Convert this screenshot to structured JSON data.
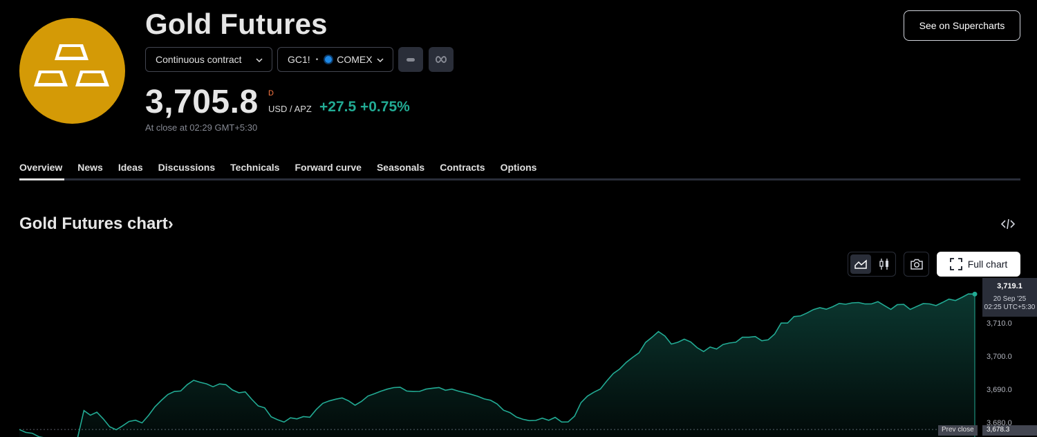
{
  "header": {
    "title": "Gold Futures",
    "contract_select": "Continuous contract",
    "symbol": "GC1!",
    "exchange": "COMEX",
    "see_supercharts": "See on Supercharts",
    "logo_icon": "gold-bars-icon"
  },
  "quote": {
    "price": "3,705.8",
    "period": "D",
    "currency": "USD / APZ",
    "change": "+27.5",
    "change_pct": "+0.75%",
    "close_time": "At close at 02:29 GMT+5:30",
    "up_color": "#22ab94"
  },
  "tabs": [
    "Overview",
    "News",
    "Ideas",
    "Discussions",
    "Technicals",
    "Forward curve",
    "Seasonals",
    "Contracts",
    "Options"
  ],
  "chart_section": {
    "title": "Gold Futures chart›",
    "full_chart": "Full chart",
    "tooltip": {
      "price": "3,719.1",
      "date": "20 Sep '25",
      "time": "02:25 UTC+5:30"
    },
    "prev_close_label": "Prev close",
    "prev_close_value": "3,678.3",
    "y_ticks": [
      "3,710.0",
      "3,700.0",
      "3,690.0",
      "3,680.0"
    ]
  },
  "chart_data": {
    "type": "area",
    "series": [
      {
        "values": [
          3678.3,
          3678.0,
          3677.2,
          3676.5,
          3676.0,
          3675.5,
          3675.2,
          3675.0,
          3675.0,
          3675.3,
          3684.0,
          3682.5,
          3683.0,
          3681.5,
          3679.0,
          3678.5,
          3680.0,
          3681.0,
          3681.5,
          3680.5,
          3683.0,
          3685.5,
          3687.5,
          3688.5,
          3689.2,
          3689.5,
          3691.5,
          3692.5,
          3692.0,
          3691.7,
          3691.8,
          3692.5,
          3692.0,
          3690.5,
          3689.5,
          3690.0,
          3688.0,
          3686.0,
          3684.5,
          3682.0,
          3681.0,
          3680.5,
          3681.5,
          3681.0,
          3682.0,
          3682.5,
          3684.5,
          3686.5,
          3687.0,
          3687.5,
          3688.0,
          3687.0,
          3685.5,
          3686.5,
          3688.0,
          3689.0,
          3689.5,
          3690.0,
          3690.5,
          3690.5,
          3690.0,
          3689.8,
          3690.3,
          3690.5,
          3690.8,
          3691.0,
          3690.5,
          3690.0,
          3689.5,
          3689.0,
          3688.5,
          3688.0,
          3687.0,
          3686.5,
          3685.5,
          3684.5,
          3683.5,
          3682.5,
          3681.5,
          3681.0,
          3681.5,
          3682.0,
          3680.5,
          3681.5,
          3680.0,
          3680.2,
          3682.0,
          3686.0,
          3688.0,
          3689.5,
          3691.0,
          3693.0,
          3695.5,
          3697.0,
          3699.0,
          3700.5,
          3702.0,
          3704.0,
          3705.5,
          3707.5,
          3706.0,
          3704.0,
          3704.0,
          3705.0,
          3705.0,
          3703.5,
          3702.0,
          3703.5,
          3703.0,
          3704.5,
          3704.5,
          3705.0,
          3705.5,
          3705.5,
          3706.0,
          3704.7,
          3705.0,
          3707.0,
          3710.0,
          3711.0,
          3712.5,
          3713.0,
          3714.0,
          3714.5,
          3715.0,
          3715.0,
          3715.5,
          3715.8,
          3716.0,
          3716.0,
          3716.2,
          3716.0,
          3716.0,
          3716.2,
          3716.0,
          3715.0,
          3716.0,
          3716.5,
          3715.0,
          3715.5,
          3716.5,
          3716.0,
          3715.5,
          3716.5,
          3717.0,
          3717.0,
          3718.0,
          3719.1,
          3719.1
        ]
      }
    ],
    "ylim": [
      3677.5,
      3721
    ],
    "grid": false,
    "line_color": "#22ab94"
  }
}
